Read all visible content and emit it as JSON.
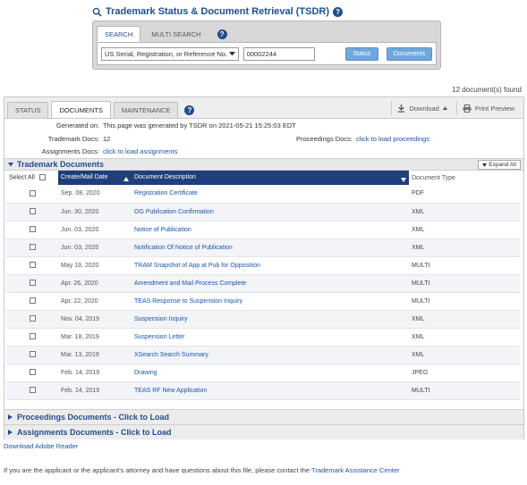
{
  "header": {
    "title": "Trademark Status & Document Retrieval (TSDR)",
    "help_icon": "?"
  },
  "search": {
    "tabs": [
      {
        "label": "SEARCH"
      },
      {
        "label": "MULTI SEARCH"
      }
    ],
    "select_value": "US Serial, Registration, or Reference No.",
    "input_value": "00002244",
    "status_button": "Status",
    "documents_button": "Documents"
  },
  "doc_count": "12 document(s) found",
  "main_tabs": [
    {
      "label": "STATUS"
    },
    {
      "label": "DOCUMENTS"
    },
    {
      "label": "MAINTENANCE"
    }
  ],
  "actions": {
    "download": "Download",
    "print_preview": "Print Preview"
  },
  "info": {
    "generated_label": "Generated on:",
    "generated_value": "This page was generated by TSDR on 2021-05-21 15:25:03 EDT",
    "trademark_docs_label": "Trademark Docs:",
    "trademark_docs_value": "12",
    "proceedings_label": "Proceedings Docs:",
    "proceedings_value": "click to load proceedings",
    "assignments_label": "Assignments Docs:",
    "assignments_value": "click to load assignments"
  },
  "trademark_section": {
    "title": "Trademark Documents",
    "expand_label": "Expand All"
  },
  "table": {
    "select_all": "Select All",
    "headers": {
      "date": "Create/Mail Date",
      "desc": "Document Description",
      "type": "Document Type"
    },
    "rows": [
      {
        "date": "Sep. 08, 2020",
        "desc": "Registration Certificate",
        "type": "PDF"
      },
      {
        "date": "Jun. 30, 2020",
        "desc": "OG Publication Confirmation",
        "type": "XML"
      },
      {
        "date": "Jun. 03, 2020",
        "desc": "Notice of Publication",
        "type": "XML"
      },
      {
        "date": "Jun. 03, 2020",
        "desc": "Notification Of Notice of Publication",
        "type": "XML"
      },
      {
        "date": "May 19, 2020",
        "desc": "TRAM Snapshot of App at Pub for Opposition",
        "type": "MULTI"
      },
      {
        "date": "Apr. 26, 2020",
        "desc": "Amendment and Mail Process Complete",
        "type": "MULTI"
      },
      {
        "date": "Apr. 22, 2020",
        "desc": "TEAS Response to Suspension Inquiry",
        "type": "MULTI"
      },
      {
        "date": "Nov. 04, 2019",
        "desc": "Suspension Inquiry",
        "type": "XML"
      },
      {
        "date": "Mar. 18, 2019",
        "desc": "Suspension Letter",
        "type": "XML"
      },
      {
        "date": "Mar. 13, 2019",
        "desc": "XSearch Search Summary",
        "type": "XML"
      },
      {
        "date": "Feb. 14, 2019",
        "desc": "Drawing",
        "type": "JPEG"
      },
      {
        "date": "Feb. 14, 2019",
        "desc": "TEAS RF New Application",
        "type": "MULTI"
      }
    ]
  },
  "proceedings_section": "Proceedings Documents - Click to Load",
  "assignments_section": "Assignments Documents - Click to Load",
  "footer": {
    "download_link": "Download Adobe Reader",
    "contact_prefix": "If you are the applicant or the applicant's attorney and have questions about this file, please contact the",
    "contact_link": "Trademark Assistance Center"
  }
}
